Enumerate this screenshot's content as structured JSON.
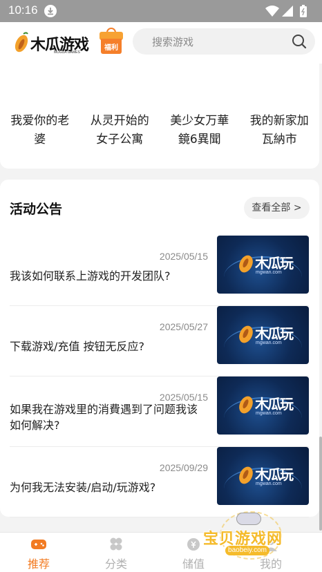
{
  "status_bar": {
    "time": "10:16"
  },
  "header": {
    "logo_text": "木瓜游戏",
    "logo_subtext": "MUGUA GAMES",
    "gift_label": "福利",
    "search_placeholder": "搜索游戏"
  },
  "games": [
    {
      "name_line1": "我爱你的老",
      "name_line2": "婆"
    },
    {
      "name_line1": "从灵开始的",
      "name_line2": "女子公寓"
    },
    {
      "name_line1": "美少女万華",
      "name_line2": "鏡6異聞"
    },
    {
      "name_line1": "我的新家加",
      "name_line2": "瓦納市"
    }
  ],
  "announcements": {
    "title": "活动公告",
    "view_all": "查看全部 >",
    "items": [
      {
        "date": "2025/05/15",
        "title": "我该如何联系上游戏的开发团队?",
        "thumb_brand": "木瓜玩",
        "thumb_site": "mgwan.com"
      },
      {
        "date": "2025/05/27",
        "title": "下载游戏/充值 按钮无反应?",
        "thumb_brand": "木瓜玩",
        "thumb_site": "mgwan.com"
      },
      {
        "date": "2025/05/15",
        "title": "如果我在游戏里的消費遇到了问题我该如何解决?",
        "thumb_brand": "木瓜玩",
        "thumb_site": "mgwan.com"
      },
      {
        "date": "2025/09/29",
        "title": "为何我无法安装/启动/玩游戏?",
        "thumb_brand": "木瓜玩",
        "thumb_site": "mgwan.com"
      }
    ]
  },
  "bottom_nav": {
    "tabs": [
      {
        "label": "推荐",
        "active": true
      },
      {
        "label": "分类",
        "active": false
      },
      {
        "label": "储值",
        "active": false
      },
      {
        "label": "我的",
        "active": false
      }
    ]
  },
  "watermark": {
    "text": "宝贝游戏网",
    "url": "baobeiy.com"
  },
  "colors": {
    "accent": "#f27b22",
    "inactive": "#b0b0b0",
    "status_bar": "#9a9a9a"
  }
}
